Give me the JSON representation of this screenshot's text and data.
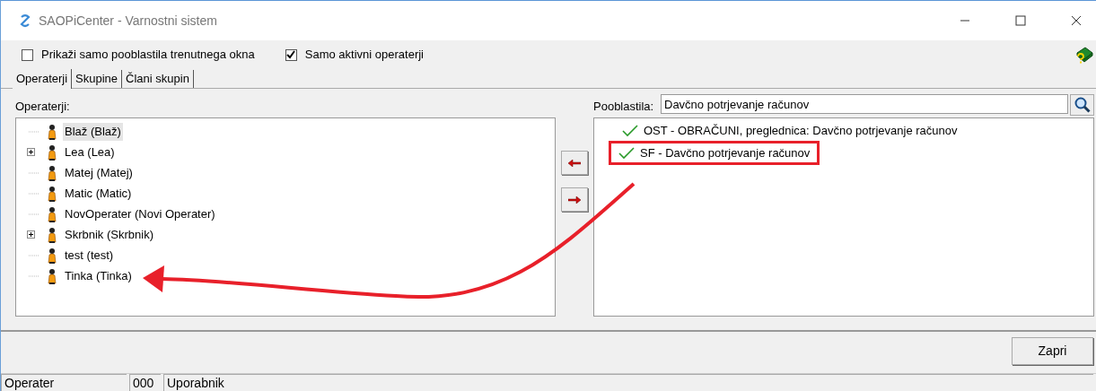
{
  "window": {
    "title": "SAOPiCenter - Varnostni sistem"
  },
  "options": [
    {
      "label": "Prikaži samo pooblastila trenutnega okna",
      "checked": false
    },
    {
      "label": "Samo aktivni operaterji",
      "checked": true
    }
  ],
  "tabs": [
    {
      "label": "Operaterji",
      "selected": true
    },
    {
      "label": "Skupine",
      "selected": false
    },
    {
      "label": "Člani skupin",
      "selected": false
    }
  ],
  "operators": {
    "label": "Operaterji:",
    "items": [
      {
        "label": "Blaž (Blaž)",
        "expandable": false,
        "selected": true
      },
      {
        "label": "Lea (Lea)",
        "expandable": true,
        "selected": false
      },
      {
        "label": "Matej (Matej)",
        "expandable": false,
        "selected": false
      },
      {
        "label": "Matic (Matic)",
        "expandable": false,
        "selected": false
      },
      {
        "label": "NovOperater (Novi Operater)",
        "expandable": false,
        "selected": false
      },
      {
        "label": "Skrbnik (Skrbnik)",
        "expandable": true,
        "selected": false
      },
      {
        "label": "test (test)",
        "expandable": false,
        "selected": false
      },
      {
        "label": "Tinka (Tinka)",
        "expandable": false,
        "selected": false
      }
    ]
  },
  "permissions": {
    "label": "Pooblastila:",
    "search_value": "Davčno potrjevanje računov",
    "items": [
      {
        "label": "OST - OBRAČUNI, preglednica: Davčno potrjevanje računov",
        "highlighted": false
      },
      {
        "label": "SF - Davčno potrjevanje računov",
        "highlighted": true
      }
    ]
  },
  "close_button": "Zapri",
  "status_bar": [
    "Operater",
    "000",
    "Uporabnik"
  ]
}
